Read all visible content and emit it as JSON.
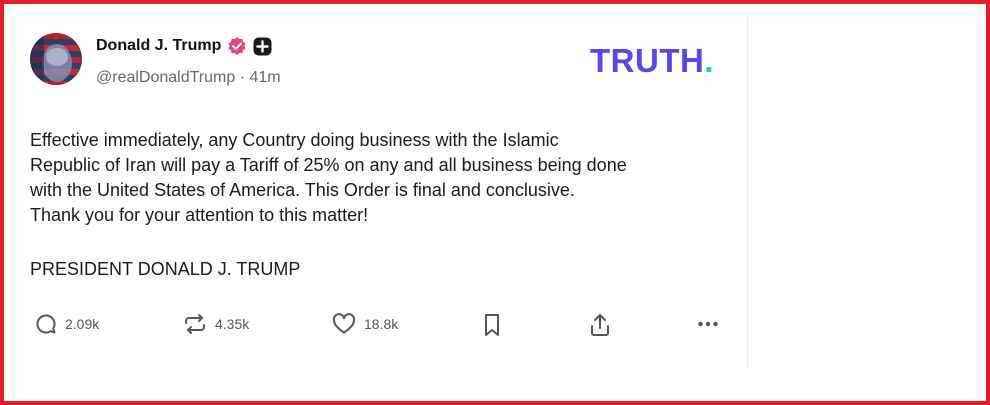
{
  "post": {
    "author_name": "Donald J. Trump",
    "handle": "@realDonaldTrump",
    "time_sep": " · ",
    "time_ago": "41m",
    "body_lines": [
      "Effective immediately, any Country doing business with the Islamic",
      "Republic of Iran will pay a Tariff of 25% on any and all business being done",
      "with the United States of America. This Order is final and conclusive.",
      "Thank you for your attention to this matter!"
    ],
    "signature": "PRESIDENT DONALD J. TRUMP"
  },
  "brand": {
    "wordmark": "TRUTH",
    "wordmark_dot": "."
  },
  "actions": {
    "replies": "2.09k",
    "retruths": "4.35k",
    "likes": "18.8k"
  },
  "icons": {
    "reply": "comment-bubble-icon",
    "retruth": "repost-arrows-icon",
    "like": "heart-icon",
    "bookmark": "bookmark-icon",
    "share": "share-upload-icon",
    "more": "more-dots-icon",
    "verified": "verified-badge-icon",
    "plus": "plus-badge-icon"
  },
  "colors": {
    "frame": "#e31e24",
    "brand_purple": "#5448ee",
    "brand_teal": "#19d3b0",
    "verified": "#e4467a",
    "muted": "#666666"
  }
}
